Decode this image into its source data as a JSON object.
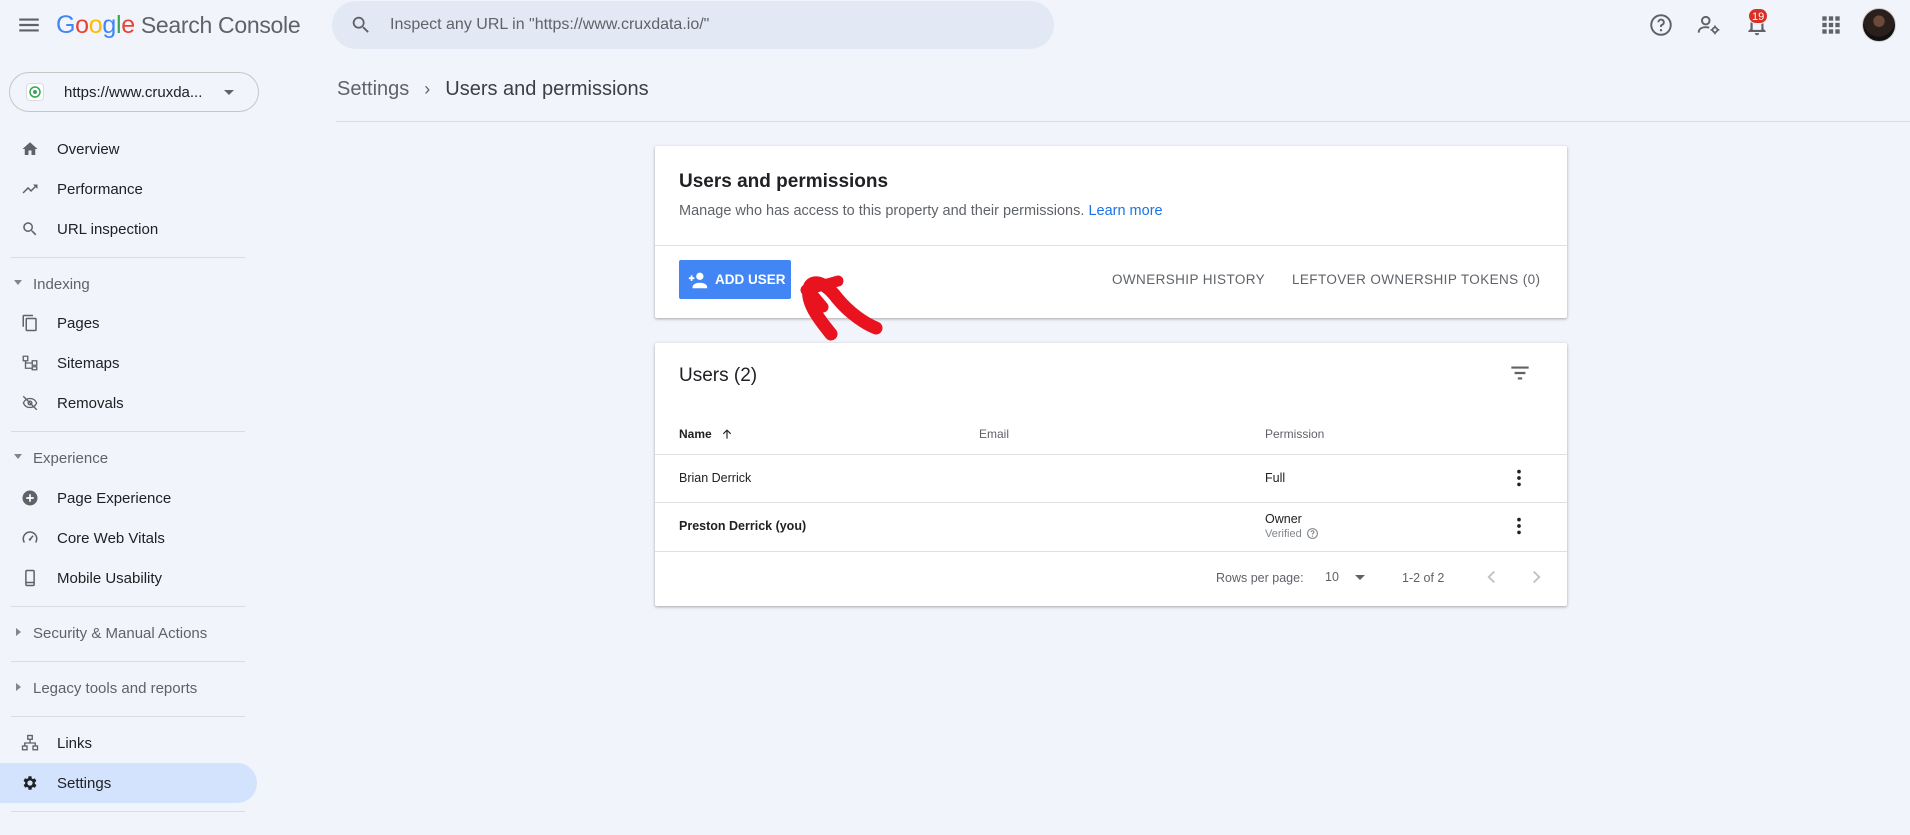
{
  "app": {
    "logo_letters": [
      "G",
      "o",
      "o",
      "g",
      "l",
      "e"
    ],
    "product": "Search Console"
  },
  "search": {
    "placeholder": "Inspect any URL in \"https://www.cruxdata.io/\""
  },
  "notifications": {
    "count": "19"
  },
  "property": {
    "url": "https://www.cruxda..."
  },
  "sidebar": {
    "top_items": [
      {
        "label": "Overview",
        "icon": "home-icon"
      },
      {
        "label": "Performance",
        "icon": "trending-up-icon"
      },
      {
        "label": "URL inspection",
        "icon": "search-icon"
      }
    ],
    "indexing": {
      "label": "Indexing",
      "items": [
        {
          "label": "Pages",
          "icon": "pages-icon"
        },
        {
          "label": "Sitemaps",
          "icon": "sitemap-icon"
        },
        {
          "label": "Removals",
          "icon": "visibility-off-icon"
        }
      ]
    },
    "experience": {
      "label": "Experience",
      "items": [
        {
          "label": "Page Experience",
          "icon": "plus-circle-icon"
        },
        {
          "label": "Core Web Vitals",
          "icon": "speed-icon"
        },
        {
          "label": "Mobile Usability",
          "icon": "smartphone-icon"
        }
      ]
    },
    "security": {
      "label": "Security & Manual Actions"
    },
    "legacy": {
      "label": "Legacy tools and reports"
    },
    "bottom_items": [
      {
        "label": "Links",
        "icon": "links-icon"
      },
      {
        "label": "Settings",
        "icon": "gear-icon",
        "active": true
      }
    ]
  },
  "breadcrumb": {
    "parent": "Settings",
    "separator": "›",
    "current": "Users and permissions"
  },
  "permissions_card": {
    "title": "Users and permissions",
    "description": "Manage who has access to this property and their permissions.",
    "learn_more": "Learn more",
    "add_user_label": "ADD USER",
    "ownership_history_label": "OWNERSHIP HISTORY",
    "leftover_tokens_label": "LEFTOVER OWNERSHIP TOKENS (0)"
  },
  "users_card": {
    "title": "Users (2)",
    "columns": {
      "name": "Name",
      "email": "Email",
      "permission": "Permission"
    },
    "rows": [
      {
        "name": "Brian Derrick",
        "email": "",
        "permission": "Full",
        "sub": ""
      },
      {
        "name": "Preston Derrick (you)",
        "email": "",
        "permission": "Owner",
        "sub": "Verified"
      }
    ],
    "rows_per_page_label": "Rows per page:",
    "rows_per_page_value": "10",
    "range": "1-2 of 2"
  },
  "colors": {
    "accent": "#4285f4",
    "active_nav": "#d3e3fd",
    "background": "#f1f4fa",
    "badge": "#d93025",
    "annotation": "#e8131f"
  }
}
